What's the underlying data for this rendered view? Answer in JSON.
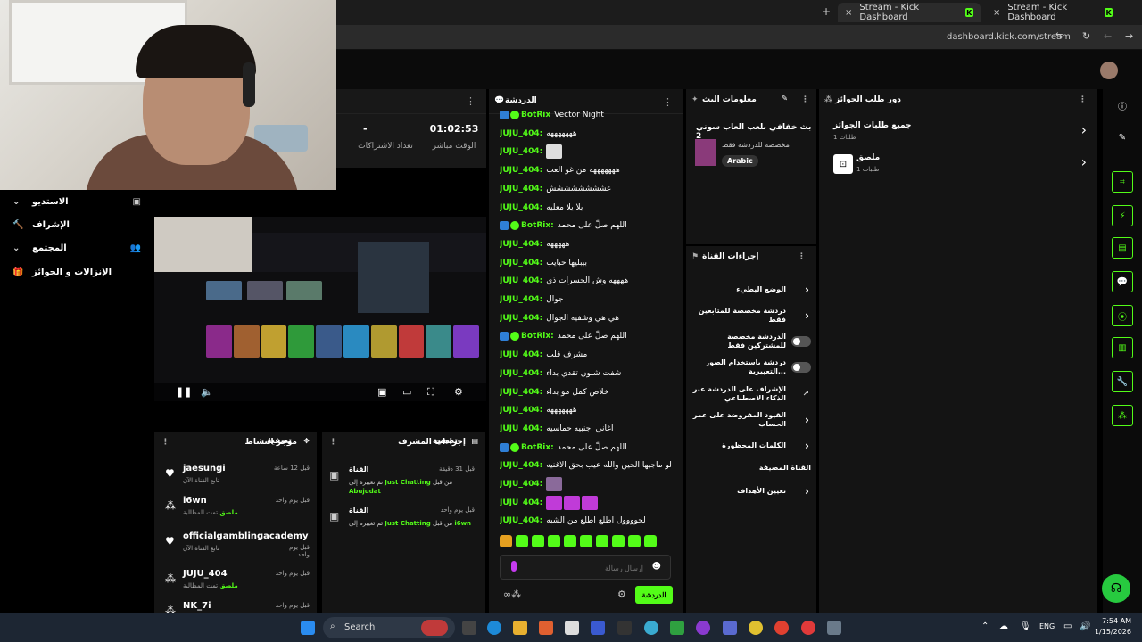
{
  "browser": {
    "tabs": [
      {
        "title": "Stream - Kick Dashboard",
        "active": true
      },
      {
        "title": "Stream - Kick Dashboard",
        "active": false
      }
    ],
    "url": "dashboard.kick.com/stream",
    "new_tab": "+",
    "close": "×"
  },
  "stats": {
    "uptime": "01:02:53",
    "uptime_label": "الوقت مباشر",
    "subs": "-",
    "subs_label": "تعداد الاشتراكات"
  },
  "sidemenu": [
    {
      "label": "الاستديو",
      "icon": "▣"
    },
    {
      "label": "الإشراف",
      "icon": "🔨"
    },
    {
      "label": "المجتمع",
      "icon": "👥"
    },
    {
      "label": "الإنزالات و الجوائز",
      "icon": "🎁"
    }
  ],
  "activity": {
    "title": "موجز النشاط",
    "filter": "تصفية",
    "items": [
      {
        "icon": "♥",
        "name": "jaesungi",
        "sub": "تابع القناة الآن",
        "tag": "",
        "time": "قبل 12 ساعة"
      },
      {
        "icon": "⁂",
        "name": "i6wn",
        "sub": "تمت المطالبة",
        "tag": "ملصق",
        "time": "قبل يوم واحد"
      },
      {
        "icon": "♥",
        "name": "officialgamblingacademy",
        "sub": "تابع القناة الآن",
        "tag": "",
        "time": "قبل يوم واحد"
      },
      {
        "icon": "⁂",
        "name": "JUJU_404",
        "sub": "تمت المطالبة",
        "tag": "ملصق",
        "time": "قبل يوم واحد"
      },
      {
        "icon": "⁂",
        "name": "NK_7i",
        "sub": "",
        "tag": "",
        "time": "قبل يوم واحد"
      }
    ]
  },
  "modactions": {
    "title": "إجراءات المشرف",
    "filter": "تصفية",
    "items": [
      {
        "name": "القناة",
        "time": "قبل 31 دقيقة",
        "pre": "تم تغييره إلى",
        "category": "Just Chatting",
        "post": "من قبل",
        "user": "Abujudat"
      },
      {
        "name": "القناة",
        "time": "قبل يوم واحد",
        "pre": "تم تغييره إلى",
        "category": "Just Chatting",
        "post": "من قبل",
        "user": "i6wn"
      }
    ]
  },
  "chat": {
    "title": "الدردشة",
    "messages": [
      {
        "user": "BotRix",
        "bot": true,
        "text": "Vector Night",
        "emote": ""
      },
      {
        "user": "JUJU_404:",
        "bot": false,
        "text": "هههههههه",
        "emote": ""
      },
      {
        "user": "JUJU_404:",
        "bot": false,
        "text": "",
        "emote": "w"
      },
      {
        "user": "JUJU_404:",
        "bot": false,
        "text": "هههههههه من غو العب",
        "emote": ""
      },
      {
        "user": "JUJU_404:",
        "bot": false,
        "text": "عشششششششش",
        "emote": ""
      },
      {
        "user": "JUJU_404:",
        "bot": false,
        "text": "يلا يلا معليه",
        "emote": ""
      },
      {
        "user": "BotRix:",
        "bot": true,
        "text": "اللهم صلّ على محمد",
        "emote": ""
      },
      {
        "user": "JUJU_404:",
        "bot": false,
        "text": "هههههه",
        "emote": ""
      },
      {
        "user": "JUJU_404:",
        "bot": false,
        "text": "بيبليها حبايب",
        "emote": ""
      },
      {
        "user": "JUJU_404:",
        "bot": false,
        "text": "ههههه وش الحسرات ذي",
        "emote": ""
      },
      {
        "user": "JUJU_404:",
        "bot": false,
        "text": "جوال",
        "emote": ""
      },
      {
        "user": "JUJU_404:",
        "bot": false,
        "text": "هي هي وشفيه الجوال",
        "emote": ""
      },
      {
        "user": "BotRix:",
        "bot": true,
        "text": "اللهم صلّ على محمد",
        "emote": ""
      },
      {
        "user": "JUJU_404:",
        "bot": false,
        "text": "مشرف قلب",
        "emote": ""
      },
      {
        "user": "JUJU_404:",
        "bot": false,
        "text": "شفت شلون تقدي بداء",
        "emote": ""
      },
      {
        "user": "JUJU_404:",
        "bot": false,
        "text": "خلاص كمل مو بداء",
        "emote": ""
      },
      {
        "user": "JUJU_404:",
        "bot": false,
        "text": "هههههههه",
        "emote": ""
      },
      {
        "user": "JUJU_404:",
        "bot": false,
        "text": "اغاني اجنبيه حماسيه",
        "emote": ""
      },
      {
        "user": "BotRix:",
        "bot": true,
        "text": "اللهم صلّ على محمد",
        "emote": ""
      },
      {
        "user": "JUJU_404:",
        "bot": false,
        "text": "لو ماجيها الحين والله عيب بحق الاغنيه",
        "emote": ""
      },
      {
        "user": "JUJU_404:",
        "bot": false,
        "text": "",
        "emote": "m"
      },
      {
        "user": "JUJU_404:",
        "bot": false,
        "text": "",
        "emote": "ppp"
      },
      {
        "user": "JUJU_404:",
        "bot": false,
        "text": "لحوووول اطلع اطلع من الشبه",
        "emote": ""
      }
    ],
    "input_placeholder": "إرسال رسالة",
    "send_label": "الدردشة"
  },
  "streaminfo": {
    "title": "معلومات البث",
    "stream_title": "بث خفافي نلعب العاب سوني 2",
    "chat_mode": "مخصصة للدردشة فقط",
    "language": "Arabic"
  },
  "channelactions": {
    "title": "إجراءات القناة",
    "items": [
      {
        "label": "الوضع البطيء",
        "type": "arrow"
      },
      {
        "label": "دردشة مخصصة للمتابعين فقط",
        "type": "arrow"
      },
      {
        "label": "الدردشة مخصصة للمشتركين فقط",
        "type": "toggle"
      },
      {
        "label": "دردشة باستخدام الصور التعبيرية...",
        "type": "toggle"
      },
      {
        "label": "الإشراف على الدردشة عبر الذكاء الاصطناعي",
        "type": "ext"
      },
      {
        "label": "القيود المفروضة على عمر الحساب",
        "type": "arrow"
      },
      {
        "label": "الكلمات المحظورة",
        "type": "arrow"
      },
      {
        "label": "القناة المضيفة",
        "type": "none"
      },
      {
        "label": "تعيين الأهداف",
        "type": "arrow"
      }
    ]
  },
  "rewards": {
    "title": "دور طلب الجوائز",
    "items": [
      {
        "name": "جميع طلبات الجوائز",
        "sub": "طلبات 1"
      },
      {
        "name": "ملصق",
        "sub": "طلبات 1"
      }
    ]
  },
  "taskbar": {
    "search": "Search",
    "lang": "ENG",
    "time": "7:54 AM",
    "date": "1/15/2026"
  },
  "colors": {
    "accent": "#53fc18",
    "panel": "#141414",
    "bg": "#000000"
  }
}
